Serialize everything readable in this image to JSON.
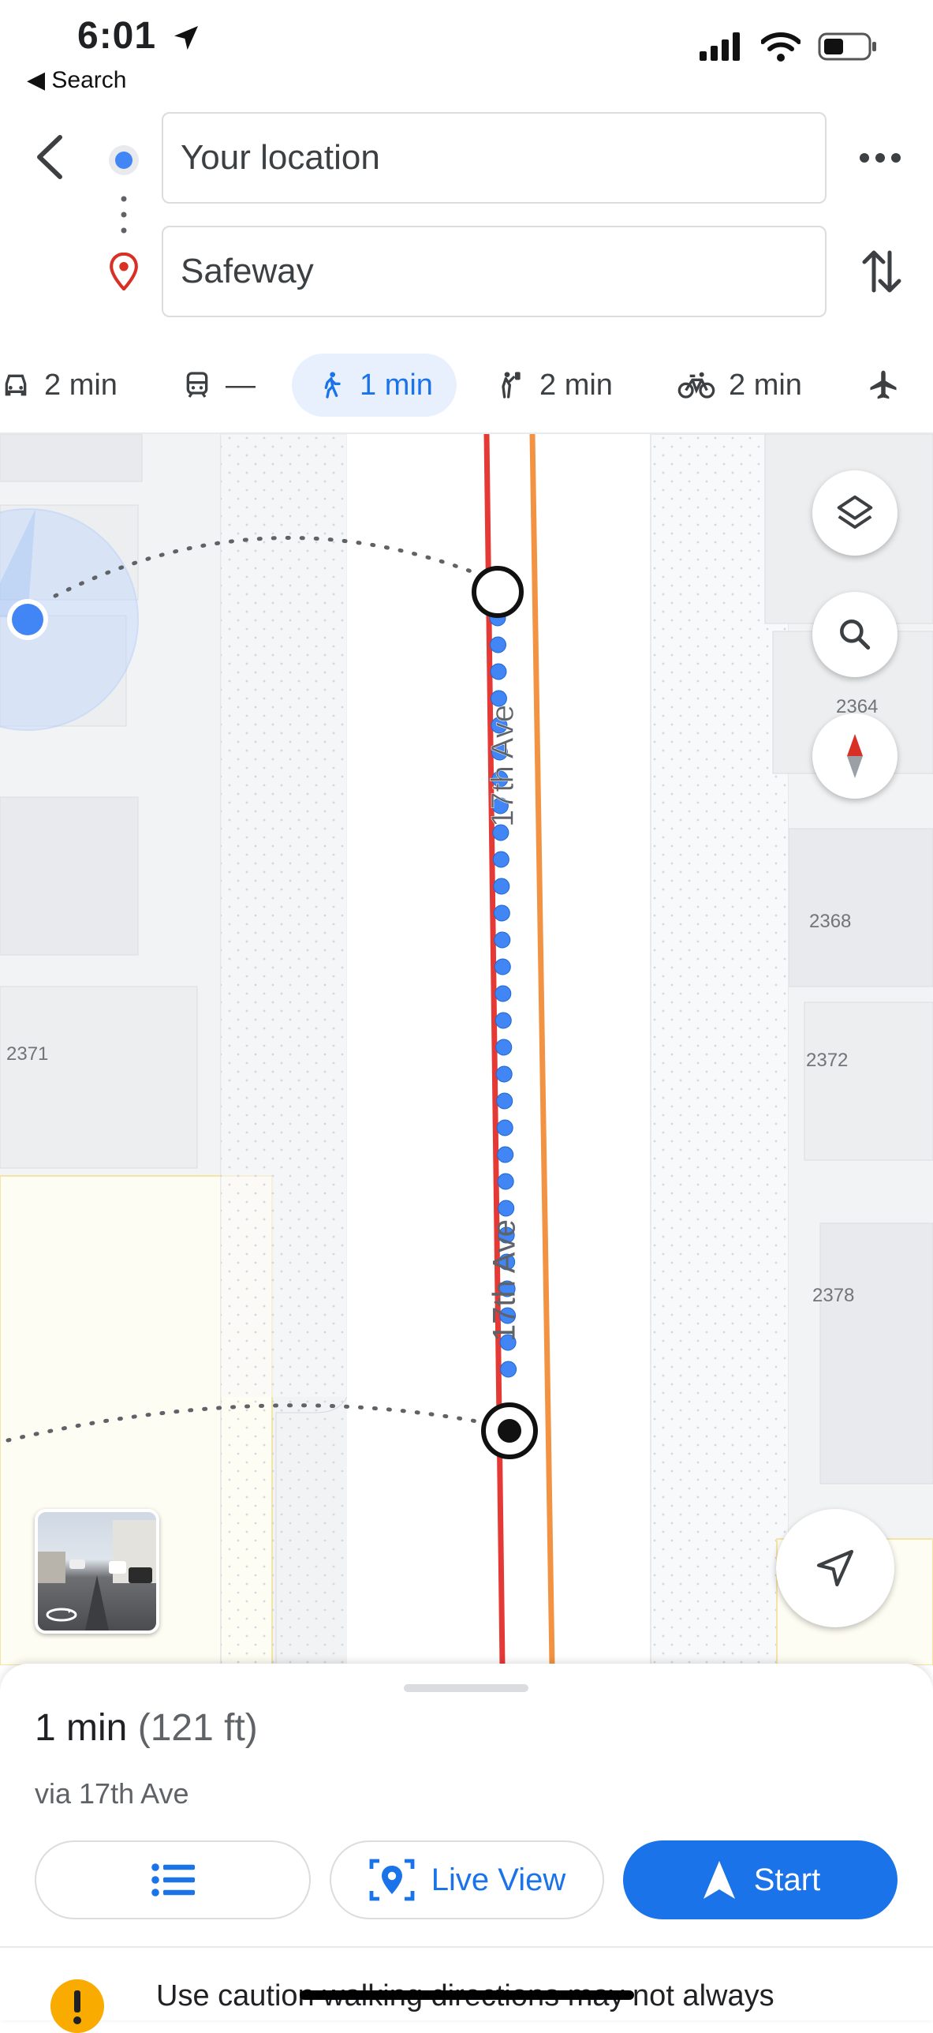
{
  "status_bar": {
    "time": "6:01",
    "back_app": "◀ Search"
  },
  "directions": {
    "origin": "Your location",
    "destination": "Safeway"
  },
  "modes": [
    {
      "name": "drive",
      "label": "2 min"
    },
    {
      "name": "transit",
      "label": "—"
    },
    {
      "name": "walk",
      "label": "1 min",
      "active": true
    },
    {
      "name": "ride",
      "label": "2 min"
    },
    {
      "name": "bike",
      "label": "2 min"
    }
  ],
  "map": {
    "street_name": "17th Ave",
    "addresses": [
      "2364",
      "2368",
      "2371",
      "2372",
      "2378"
    ]
  },
  "route": {
    "duration": "1 min",
    "distance": "(121 ft)",
    "via": "via 17th Ave"
  },
  "actions": {
    "live_view": "Live View",
    "start": "Start"
  },
  "caution_text": "Use caution  walking directions may not always",
  "colors": {
    "accent": "#1a73e8",
    "route_dot": "#4285f4",
    "street_red": "#e53935",
    "street_orange": "#f29343"
  }
}
